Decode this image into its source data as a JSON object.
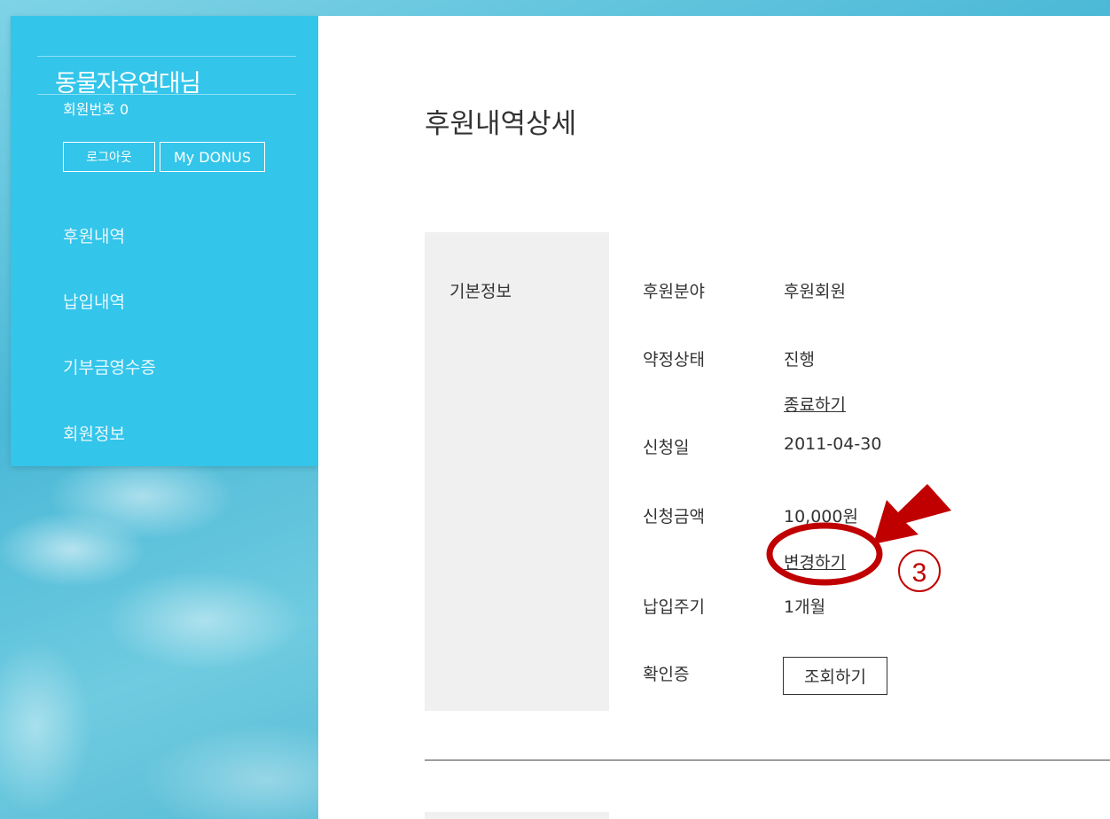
{
  "sidebar": {
    "user_name": "동물자유연대님",
    "member_no": "회원번호 0",
    "logout_label": "로그아웃",
    "mydonus_label": "My DONUS",
    "nav": [
      "후원내역",
      "납입내역",
      "기부금영수증",
      "회원정보"
    ]
  },
  "main": {
    "title": "후원내역상세",
    "section_label": "기본정보",
    "fields": {
      "area_label": "후원분야",
      "area_value": "후원회원",
      "status_label": "약정상태",
      "status_value": "진행",
      "end_link": "종료하기",
      "date_label": "신청일",
      "date_value": "2011-04-30",
      "amount_label": "신청금액",
      "amount_value": "10,000원",
      "change_link": "변경하기",
      "cycle_label": "납입주기",
      "cycle_value": "1개월",
      "cert_label": "확인증",
      "view_button": "조회하기"
    }
  },
  "annotation": {
    "step_number": "3",
    "color": "#c00000"
  },
  "colors": {
    "sidebar": "#33c5ea",
    "panel": "#f0f0f0"
  }
}
